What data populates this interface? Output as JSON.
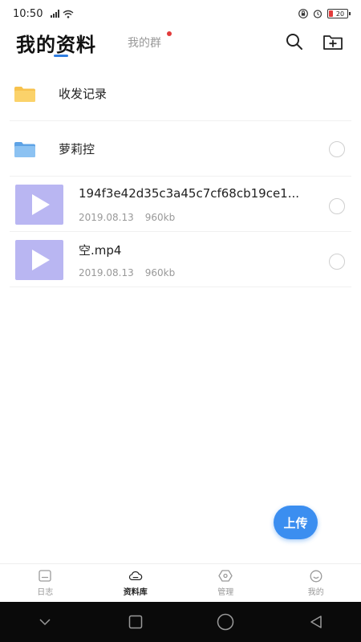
{
  "status_bar": {
    "time": "10:50",
    "battery": "20"
  },
  "header": {
    "title": "我的资料",
    "tab_groups": "我的群"
  },
  "folders": [
    {
      "name": "收发记录",
      "color": "#f7c24d",
      "has_radio": false
    },
    {
      "name": "萝莉控",
      "color": "#7fb8ef",
      "has_radio": true
    }
  ],
  "files": [
    {
      "name": "194f3e42d35c3a45c7cf68cb19ce1...",
      "date": "2019.08.13",
      "size": "960kb"
    },
    {
      "name": "空.mp4",
      "date": "2019.08.13",
      "size": "960kb"
    }
  ],
  "upload_label": "上传",
  "bottom_nav": [
    {
      "label": "日志",
      "icon": "journal-icon",
      "active": false
    },
    {
      "label": "资料库",
      "icon": "cloud-icon",
      "active": true
    },
    {
      "label": "管理",
      "icon": "manage-icon",
      "active": false
    },
    {
      "label": "我的",
      "icon": "profile-icon",
      "active": false
    }
  ],
  "colors": {
    "accent": "#3b8ef0",
    "video_thumb": "#b9b6f2",
    "badge": "#e23b3b"
  }
}
